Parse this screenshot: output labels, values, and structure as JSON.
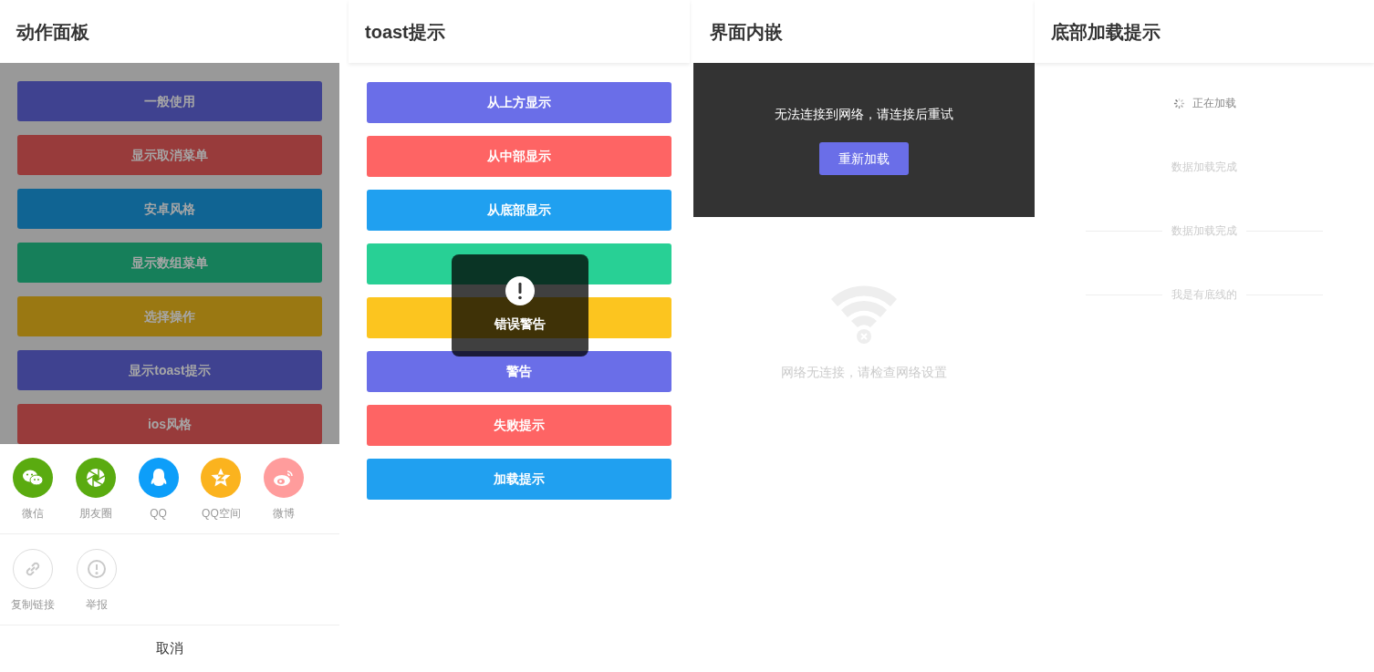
{
  "action_sheet_panel": {
    "title": "动作面板",
    "buttons": [
      {
        "label": "一般使用",
        "color": "#3f4290"
      },
      {
        "label": "显示取消菜单",
        "color": "#983b3b"
      },
      {
        "label": "安卓风格",
        "color": "#106493"
      },
      {
        "label": "显示数组菜单",
        "color": "#167f5a"
      },
      {
        "label": "选择操作",
        "color": "#9a7812"
      },
      {
        "label": "显示toast提示",
        "color": "#3f4290"
      },
      {
        "label": "ios风格",
        "color": "#983b3b"
      }
    ],
    "share_items": [
      {
        "label": "微信",
        "color": "#5aab10"
      },
      {
        "label": "朋友圈",
        "color": "#5aab10"
      },
      {
        "label": "QQ",
        "color": "#0d9ef9"
      },
      {
        "label": "QQ空间",
        "color": "#fbb31e"
      },
      {
        "label": "微博",
        "color": "#ff9c9c"
      }
    ],
    "action_items": [
      {
        "label": "复制链接"
      },
      {
        "label": "举报"
      }
    ],
    "cancel": "取消"
  },
  "toast_panel": {
    "title": "toast提示",
    "buttons": [
      {
        "label": "从上方显示",
        "color": "#6a6ee8"
      },
      {
        "label": "从中部显示",
        "color": "#fe6464"
      },
      {
        "label": "从底部显示",
        "color": "#20a0f0"
      },
      {
        "color": "#28d095"
      },
      {
        "color": "#fcc51f"
      },
      {
        "label": "警告",
        "color": "#6a6ee8"
      },
      {
        "label": "失败提示",
        "color": "#fe6464"
      },
      {
        "label": "加载提示",
        "color": "#20a0f0"
      }
    ],
    "toast": {
      "text": "错误警告"
    }
  },
  "embedded_panel": {
    "title": "界面内嵌",
    "error_message": "无法连接到网络，请连接后重试",
    "reload_button": "重新加载",
    "offline_message": "网络无连接，请检查网络设置"
  },
  "bottom_loading_panel": {
    "title": "底部加载提示",
    "rows": [
      {
        "kind": "loading",
        "text": "正在加载"
      },
      {
        "kind": "plain",
        "text": "数据加载完成"
      },
      {
        "kind": "lined",
        "text": "数据加载完成"
      },
      {
        "kind": "lined",
        "text": "我是有底线的"
      }
    ]
  }
}
